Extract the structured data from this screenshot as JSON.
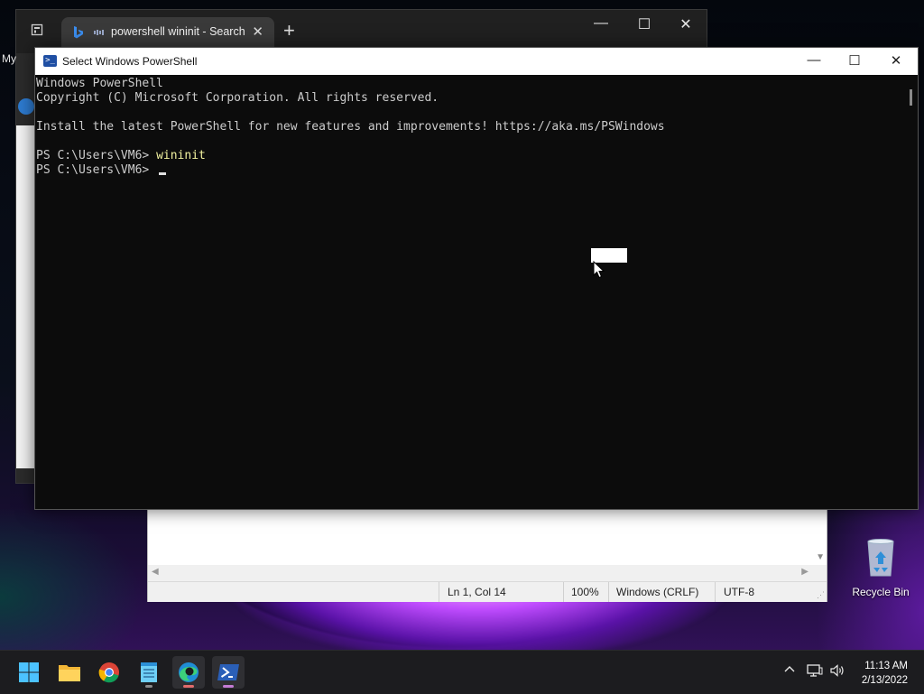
{
  "browser": {
    "tab_title": "powershell wininit - Search",
    "tab_close": "✕",
    "new_tab": "+",
    "minimize": "—",
    "maximize": "☐",
    "close": "✕",
    "side_label": "My"
  },
  "powershell": {
    "title": "Select Windows PowerShell",
    "minimize": "—",
    "maximize": "☐",
    "close": "✕",
    "lines": {
      "l1": "Windows PowerShell",
      "l2": "Copyright (C) Microsoft Corporation. All rights reserved.",
      "l3": "",
      "l4": "Install the latest PowerShell for new features and improvements! https://aka.ms/PSWindows",
      "l5": "",
      "prompt1": "PS C:\\Users\\VM6> ",
      "cmd1": "wininit",
      "prompt2": "PS C:\\Users\\VM6> "
    }
  },
  "notepad": {
    "status_position": "Ln 1, Col 14",
    "status_zoom": "100%",
    "status_line_ending": "Windows (CRLF)",
    "status_encoding": "UTF-8"
  },
  "desktop": {
    "recycle_bin_label": "Recycle Bin"
  },
  "taskbar": {
    "icons": [
      "start-icon",
      "file-explorer-icon",
      "chrome-icon",
      "notepad-icon",
      "edge-icon",
      "powershell-icon"
    ],
    "tray_chevron": "^",
    "time": "11:13 AM",
    "date": "2/13/2022"
  },
  "colors": {
    "console_bg": "#0c0c0c",
    "console_text": "#cccccc",
    "command_text": "#f3f3a0",
    "taskbar_bg": "#1c1c1f",
    "powershell_blue": "#1f4fa3"
  }
}
